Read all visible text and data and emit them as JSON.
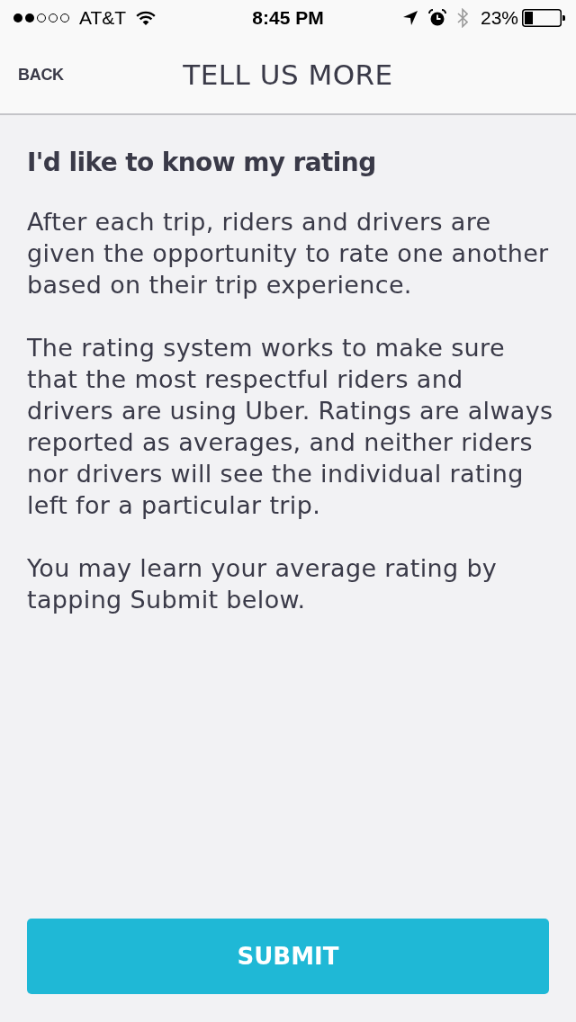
{
  "status_bar": {
    "carrier": "AT&T",
    "time": "8:45 PM",
    "battery": "23%"
  },
  "nav_bar": {
    "back": "BACK",
    "title": "TELL US MORE"
  },
  "content": {
    "heading": "I'd like to know my rating",
    "paragraphs": [
      "After each trip, riders and drivers are given the opportunity to rate one another based on their trip experience.",
      "The rating system works to make sure that the most respectful riders and drivers are using Uber. Ratings are always reported as averages, and neither riders nor drivers will see the individual rating left for a particular trip.",
      "You may learn your average rating by tapping Submit below."
    ]
  },
  "submit_button": {
    "label": "SUBMIT"
  }
}
